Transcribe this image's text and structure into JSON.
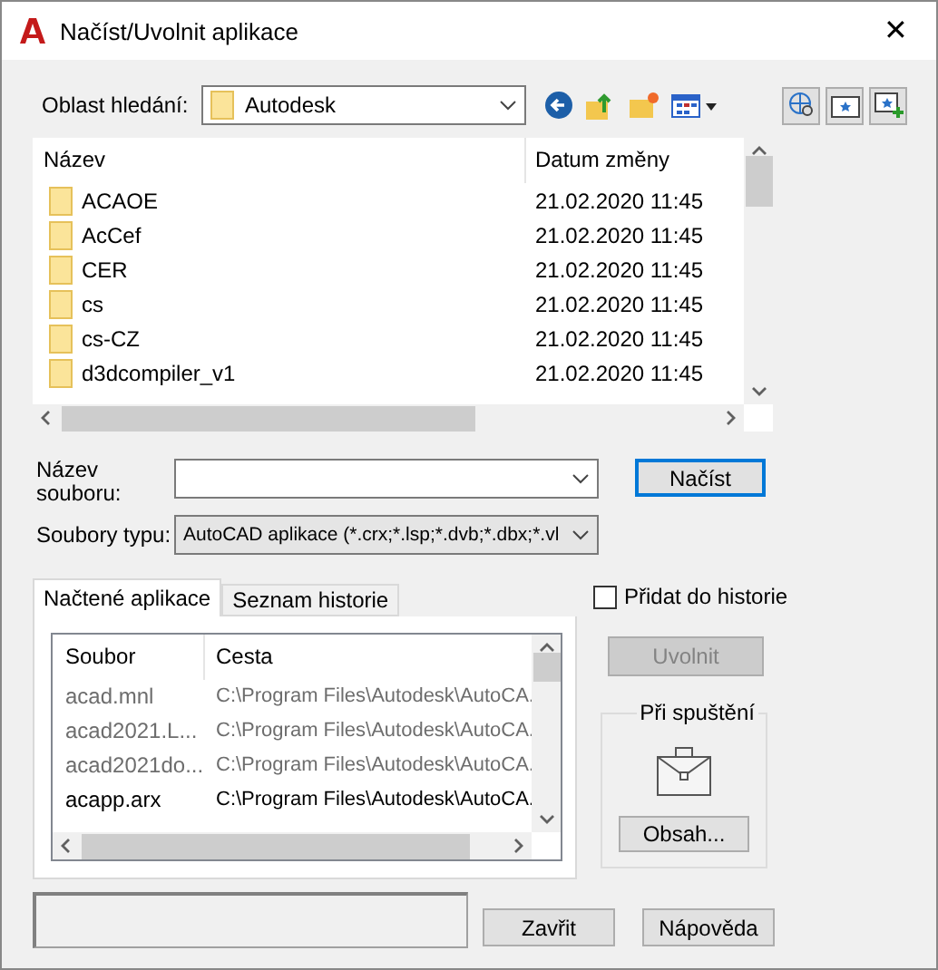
{
  "window": {
    "title": "Načíst/Uvolnit aplikace",
    "close": "✕"
  },
  "look_in": {
    "label": "Oblast hledání:",
    "value": "Autodesk"
  },
  "file_list": {
    "columns": [
      "Název",
      "Datum změny"
    ],
    "rows": [
      {
        "name": "ACAOE",
        "date": "21.02.2020 11:45"
      },
      {
        "name": "AcCef",
        "date": "21.02.2020 11:45"
      },
      {
        "name": "CER",
        "date": "21.02.2020 11:45"
      },
      {
        "name": "cs",
        "date": "21.02.2020 11:45"
      },
      {
        "name": "cs-CZ",
        "date": "21.02.2020 11:45"
      },
      {
        "name": "d3dcompiler_v1",
        "date": "21.02.2020 11:45"
      }
    ]
  },
  "file_name": {
    "label": "Název souboru:"
  },
  "load_button": "Načíst",
  "file_type": {
    "label": "Soubory typu:",
    "value": "AutoCAD aplikace (*.crx;*.lsp;*.dvb;*.dbx;*.vl"
  },
  "tabs": [
    {
      "label": "Načtené aplikace",
      "selected": true
    },
    {
      "label": "Seznam historie",
      "selected": false
    }
  ],
  "apps": {
    "columns": [
      "Soubor",
      "Cesta"
    ],
    "rows": [
      {
        "file": "acad.mnl",
        "path": "C:\\Program Files\\Autodesk\\AutoCA.",
        "dimmed": true
      },
      {
        "file": "acad2021.L...",
        "path": "C:\\Program Files\\Autodesk\\AutoCA.",
        "dimmed": true
      },
      {
        "file": "acad2021do...",
        "path": "C:\\Program Files\\Autodesk\\AutoCA.",
        "dimmed": true
      },
      {
        "file": "acapp.arx",
        "path": "C:\\Program Files\\Autodesk\\AutoCA.",
        "dimmed": false
      }
    ]
  },
  "add_to_history": {
    "label": "Přidat do historie",
    "checked": false
  },
  "unload_button": {
    "label": "Uvolnit",
    "disabled": true
  },
  "startup": {
    "title": "Při spuštění",
    "button": "Obsah..."
  },
  "buttons": [
    "Zavřit",
    "Nápověda"
  ]
}
